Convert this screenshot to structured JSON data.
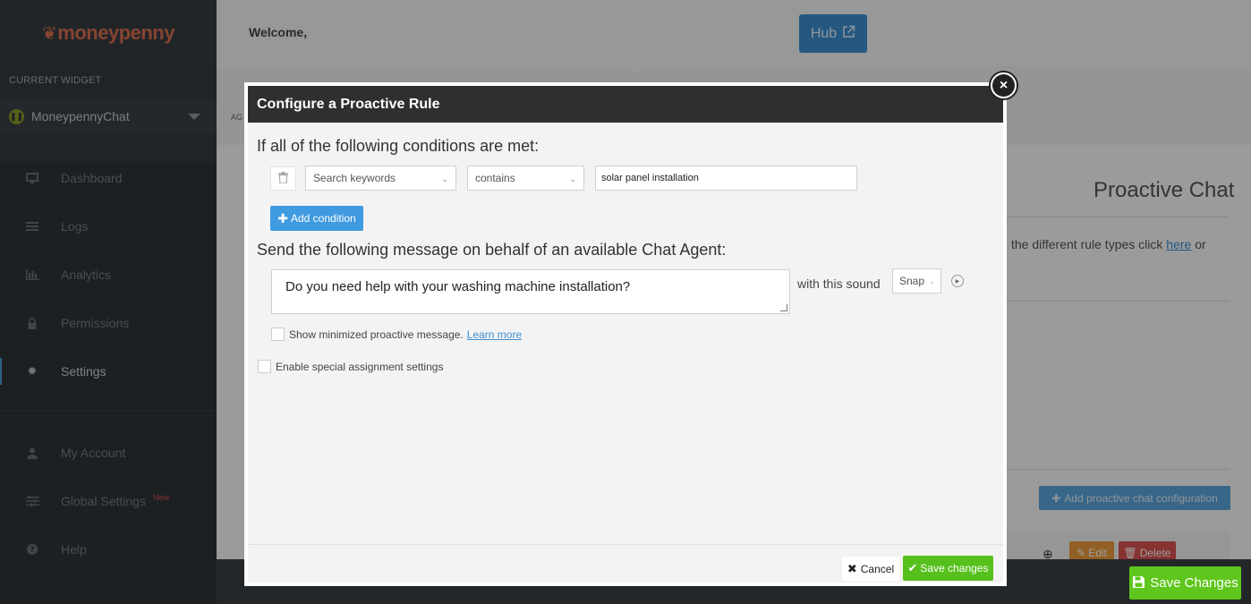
{
  "brand": {
    "logo_text": "moneypenny"
  },
  "sidebar": {
    "current_widget_label": "CURRENT WIDGET",
    "widget_name": "MoneypennyChat",
    "items": [
      {
        "label": "Dashboard",
        "icon": "monitor-icon"
      },
      {
        "label": "Logs",
        "icon": "list-icon"
      },
      {
        "label": "Analytics",
        "icon": "bar-chart-icon"
      },
      {
        "label": "Permissions",
        "icon": "lock-icon"
      },
      {
        "label": "Settings",
        "icon": "gear-icon",
        "active": true
      }
    ],
    "items2": [
      {
        "label": "My Account",
        "icon": "user-icon"
      },
      {
        "label": "Global Settings",
        "icon": "sliders-icon",
        "badge": "New"
      },
      {
        "label": "Help",
        "icon": "question-icon"
      }
    ]
  },
  "topbar": {
    "welcome": "Welcome,",
    "hub_label": "Hub"
  },
  "subbar": {
    "tab_fragment": "AG"
  },
  "main": {
    "title": "Proactive Chat",
    "info_text": "the different rule types click",
    "info_link": "here",
    "info_tail": "or",
    "add_config": "Add proactive chat configuration",
    "edit": "Edit",
    "delete": "Delete",
    "save_changes": "Save Changes"
  },
  "modal": {
    "title": "Configure a Proactive Rule",
    "conditions_heading": "If all of the following conditions are met:",
    "condition": {
      "field": "Search keywords",
      "operator": "contains",
      "value": "solar panel installation"
    },
    "add_condition": "Add condition",
    "message_heading": "Send the following message on behalf of an available Chat Agent:",
    "message": "Do you need help with your washing machine installation?",
    "sound_label": "with this sound",
    "sound": "Snap",
    "show_minimized": "Show minimized proactive message.",
    "learn_more": "Learn more",
    "enable_special": "Enable special assignment settings",
    "cancel": "Cancel",
    "save": "Save changes"
  }
}
